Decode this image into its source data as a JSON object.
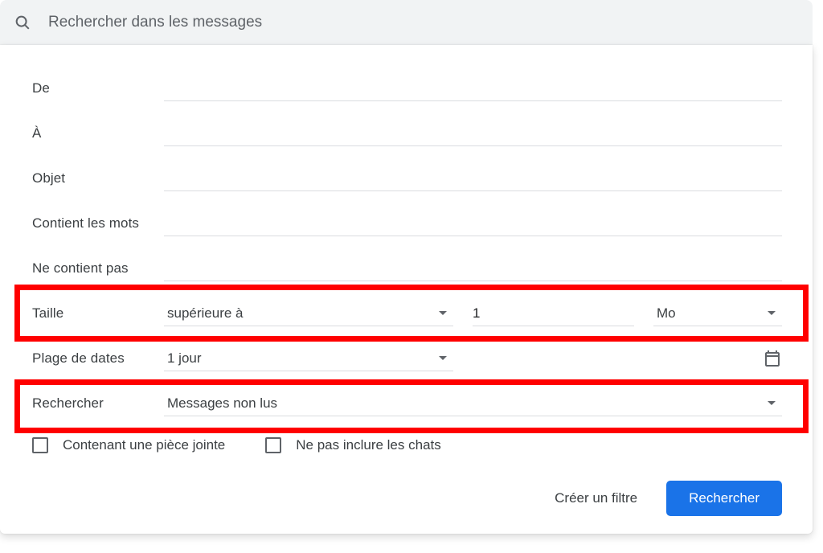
{
  "search": {
    "placeholder": "Rechercher dans les messages"
  },
  "labels": {
    "from": "De",
    "to": "À",
    "subject": "Objet",
    "has_words": "Contient les mots",
    "not_has": "Ne contient pas",
    "size": "Taille",
    "date_range": "Plage de dates",
    "search_in": "Rechercher"
  },
  "size": {
    "comparator": "supérieure à",
    "value": "1",
    "unit": "Mo"
  },
  "date_range": {
    "value": "1 jour"
  },
  "search_in": {
    "value": "Messages non lus"
  },
  "checks": {
    "has_attachment": "Contenant une pièce jointe",
    "exclude_chats": "Ne pas inclure les chats"
  },
  "actions": {
    "create_filter": "Créer un filtre",
    "search": "Rechercher"
  }
}
